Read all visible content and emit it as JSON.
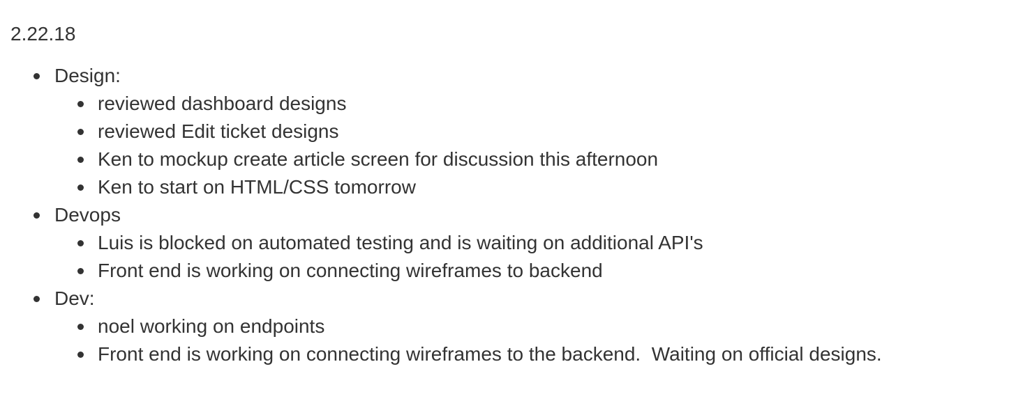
{
  "document": {
    "date": "2.22.18",
    "sections": [
      {
        "title": "Design:",
        "items": [
          "reviewed dashboard designs",
          "reviewed Edit ticket designs",
          "Ken to mockup create article screen for discussion this afternoon",
          "Ken to start on HTML/CSS tomorrow"
        ]
      },
      {
        "title": "Devops",
        "items": [
          "Luis is blocked on automated testing and is waiting on additional API's",
          "Front end is working on connecting wireframes to backend"
        ]
      },
      {
        "title": "Dev:",
        "items": [
          "noel working on endpoints",
          "Front end is working on connecting wireframes to the backend.  Waiting on official designs."
        ]
      }
    ]
  }
}
